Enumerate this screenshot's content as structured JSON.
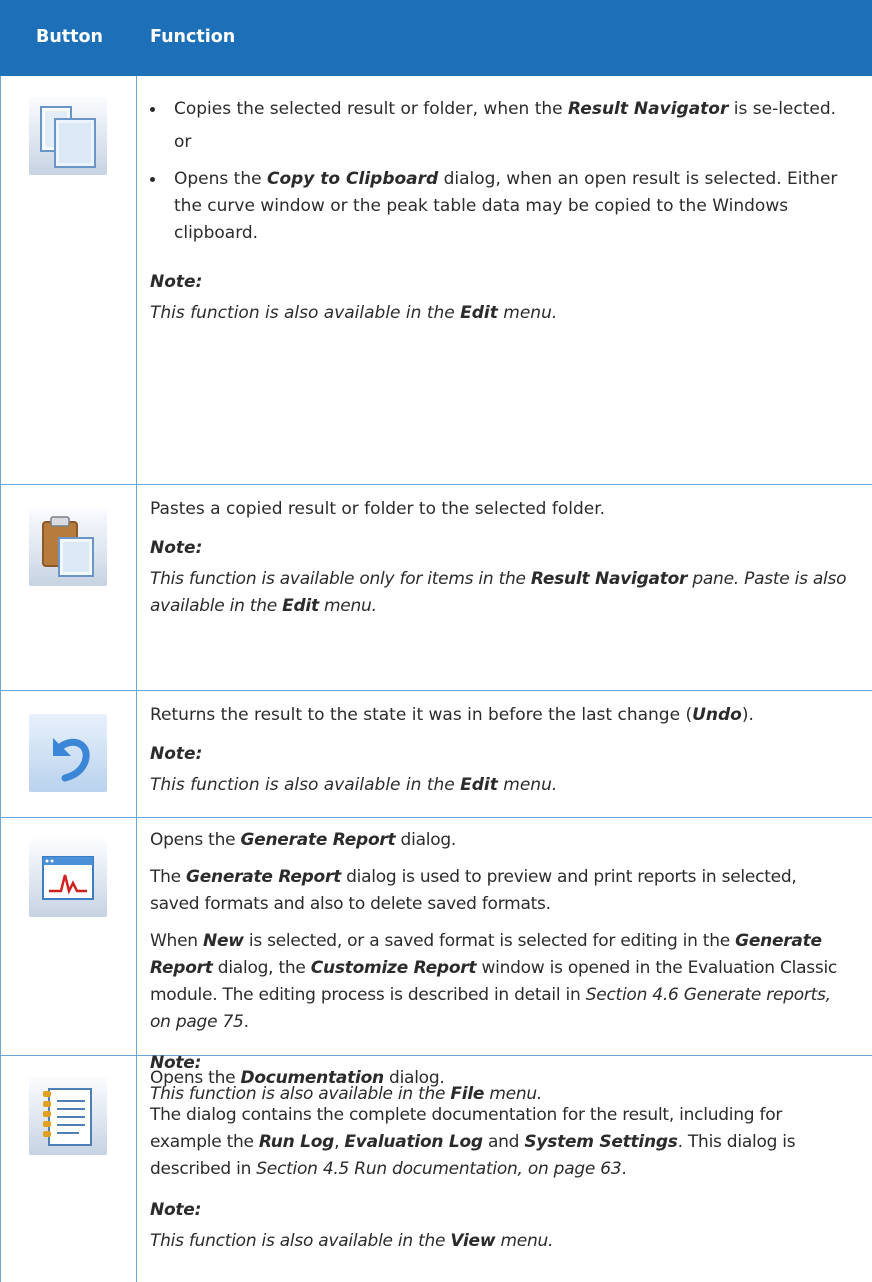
{
  "header": {
    "col_button": "Button",
    "col_function": "Function"
  },
  "rows": [
    {
      "icon": "copy-icon",
      "bullet1": [
        "Copies the selected result or folder, when the ",
        "Result Navigator",
        " is se-lected."
      ],
      "or": "or",
      "bullet2": [
        "Opens the ",
        "Copy to Clipboard",
        " dialog, when an open result is selected. Either the curve window or the peak table data may be copied to the Windows clipboard."
      ],
      "note_label": "Note:",
      "note": [
        "This function is also available in the ",
        "Edit",
        " menu."
      ]
    },
    {
      "icon": "paste-icon",
      "text": "Pastes a copied result or folder to the selected folder.",
      "note_label": "Note:",
      "note": [
        "This function is available only for items in the ",
        "Result Navigator",
        " pane. Paste is also available in the ",
        "Edit",
        " menu."
      ]
    },
    {
      "icon": "undo-icon",
      "text": [
        "Returns the result to the state it was in before the last change (",
        "Undo",
        ")."
      ],
      "note_label": "Note:",
      "note": [
        "This function is also available in the ",
        "Edit",
        " menu."
      ]
    },
    {
      "icon": "generate-report-icon",
      "p1": [
        "Opens the ",
        "Generate Report",
        " dialog."
      ],
      "p2": [
        "The ",
        "Generate Report",
        " dialog is used to preview and print reports in selected, saved formats and also to delete saved formats."
      ],
      "p3": [
        "When ",
        "New",
        " is selected, or a saved format is selected for editing in the ",
        "Generate Report",
        " dialog, the ",
        "Customize Report",
        " window is opened in the Evaluation Classic module. The editing process is described in detail in ",
        "Section 4.6 Generate reports, on page 75",
        "."
      ],
      "note_label": "Note:",
      "note": [
        "This function is also available in the ",
        "File",
        " menu."
      ]
    },
    {
      "icon": "documentation-icon",
      "p1": [
        "Opens the ",
        "Documentation",
        " dialog."
      ],
      "p2": [
        "The dialog contains the complete documentation for the result, including for example the ",
        "Run Log",
        ", ",
        "Evaluation Log",
        " and ",
        "System Settings",
        ". This dialog is described in ",
        "Section 4.5 Run documentation, on page 63",
        "."
      ],
      "note_label": "Note:",
      "note": [
        "This function is also available in the ",
        "View",
        " menu."
      ]
    }
  ]
}
